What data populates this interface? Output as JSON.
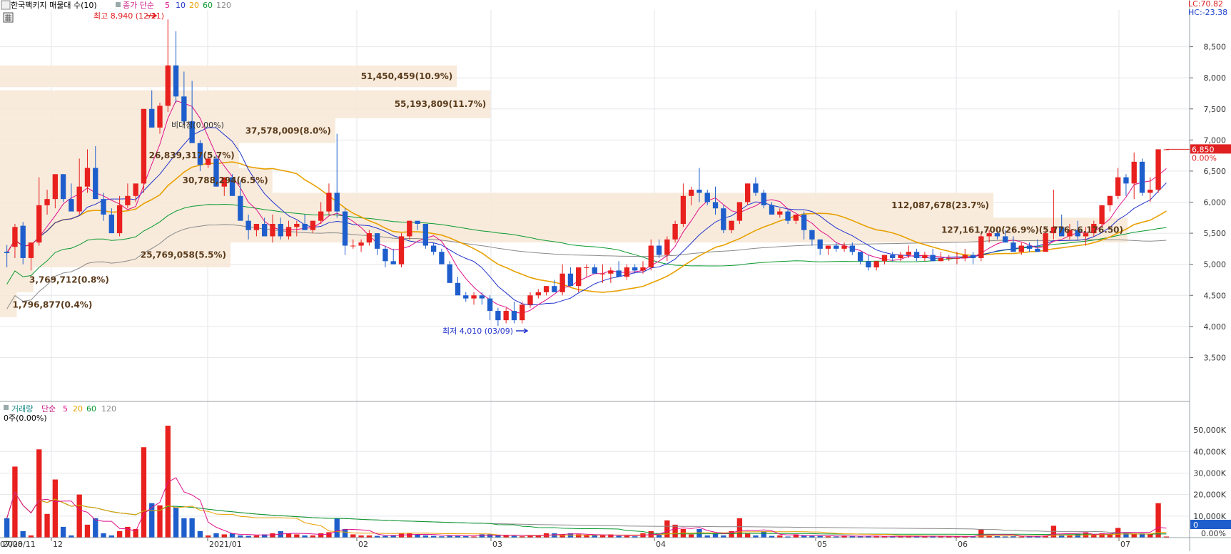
{
  "header": {
    "title": "한국팩키지 매물대 수(10)",
    "ma_label": "종가 단순",
    "ma_periods": [
      "5",
      "10",
      "20",
      "60",
      "120"
    ],
    "lc": "LC:70.82",
    "hc": "HC:-23.38"
  },
  "volume_header": {
    "title": "거래량",
    "ma_label": "단순",
    "ma_periods": [
      "5",
      "20",
      "60",
      "120"
    ],
    "current": "0주(0.00%)"
  },
  "annotations": {
    "high": "최고 8,940 (12/21)",
    "low": "최저 4,010 (03/09)",
    "bidarak": "비대칭(0.00%)"
  },
  "price_axis": {
    "ticks": [
      "8,500",
      "8,000",
      "7,500",
      "7,000",
      "6,500",
      "6,000",
      "5,500",
      "5,000",
      "4,500",
      "4,000",
      "3,500"
    ],
    "current_price": "6,850",
    "current_change": "0.00%"
  },
  "volume_axis": {
    "ticks": [
      "50,000K",
      "40,000K",
      "30,000K",
      "20,000K",
      "10,000K",
      "0.00%"
    ],
    "current": "0"
  },
  "x_axis": [
    "2020/11",
    "12",
    "2021/01",
    "02",
    "03",
    "04",
    "05",
    "06",
    "07",
    "07/08"
  ],
  "chart_data": {
    "type": "candlestick",
    "price_range": [
      3000,
      9000
    ],
    "volume_range": [
      0,
      55000
    ],
    "volume_profile": [
      {
        "label": "51,450,459(10.9%)",
        "low": 7850,
        "high": 8200,
        "pct": 10.9
      },
      {
        "label": "55,193,809(11.7%)",
        "low": 7350,
        "high": 7800,
        "pct": 11.7
      },
      {
        "label": "37,578,009(8.0%)",
        "low": 6950,
        "high": 7350,
        "pct": 8.0
      },
      {
        "label": "26,839,317(5.7%)",
        "low": 6550,
        "high": 6950,
        "pct": 5.7
      },
      {
        "label": "30,788,294(6.5%)",
        "low": 6150,
        "high": 6550,
        "pct": 6.5
      },
      {
        "label": "112,087,678(23.7%)",
        "low": 5750,
        "high": 6150,
        "pct": 23.7
      },
      {
        "label": "127,161,700(26.9%)(5.776~6.176.50)",
        "low": 5350,
        "high": 5750,
        "pct": 26.9
      },
      {
        "label": "25,769,058(5.5%)",
        "low": 4950,
        "high": 5350,
        "pct": 5.5
      },
      {
        "label": "3,769,712(0.8%)",
        "low": 4550,
        "high": 4950,
        "pct": 0.8
      },
      {
        "label": "1,796,877(0.4%)",
        "low": 4150,
        "high": 4550,
        "pct": 0.4
      }
    ],
    "candles": [
      [
        5200,
        5310,
        4950,
        5180,
        9000
      ],
      [
        5280,
        5650,
        5100,
        5600,
        33000
      ],
      [
        5620,
        5680,
        5000,
        5100,
        3000
      ],
      [
        5100,
        5200,
        4900,
        5350,
        1000
      ],
      [
        5350,
        6400,
        5300,
        5950,
        41000
      ],
      [
        5950,
        6200,
        5800,
        6050,
        11000
      ],
      [
        6050,
        6400,
        5900,
        6450,
        27000
      ],
      [
        6450,
        6450,
        6000,
        6050,
        5000
      ],
      [
        6050,
        6300,
        5900,
        5850,
        1000
      ],
      [
        5850,
        6700,
        5800,
        6250,
        20000
      ],
      [
        6250,
        6850,
        6150,
        6550,
        6000
      ],
      [
        6550,
        6900,
        6100,
        6050,
        9000
      ],
      [
        6050,
        6150,
        5700,
        5800,
        2000
      ],
      [
        5800,
        5900,
        5550,
        5500,
        1000
      ],
      [
        5500,
        6100,
        5450,
        5950,
        3000
      ],
      [
        5950,
        6300,
        5900,
        6100,
        5000
      ],
      [
        6100,
        6200,
        6000,
        6300,
        4000
      ],
      [
        6300,
        7500,
        6150,
        7500,
        42000
      ],
      [
        7500,
        7800,
        7250,
        7200,
        16000
      ],
      [
        7200,
        7600,
        7100,
        7550,
        15000
      ],
      [
        7550,
        8940,
        7450,
        8200,
        52000
      ],
      [
        8200,
        8750,
        7600,
        7700,
        14000
      ],
      [
        7700,
        8100,
        7250,
        7300,
        9000
      ],
      [
        7300,
        7950,
        7200,
        6950,
        9000
      ],
      [
        6950,
        7000,
        6500,
        6600,
        3000
      ],
      [
        6600,
        6750,
        6550,
        6700,
        1000
      ],
      [
        6700,
        6750,
        6250,
        6250,
        2000
      ],
      [
        6250,
        6400,
        6100,
        6400,
        1500
      ],
      [
        6400,
        6450,
        6100,
        6100,
        2000
      ],
      [
        6100,
        6350,
        6050,
        5700,
        1000
      ],
      [
        5700,
        5800,
        5400,
        5550,
        800
      ],
      [
        5550,
        5650,
        5450,
        5650,
        1000
      ],
      [
        5650,
        5750,
        5500,
        5450,
        1500
      ],
      [
        5450,
        5800,
        5350,
        5650,
        2000
      ],
      [
        5650,
        5750,
        5400,
        5450,
        3000
      ],
      [
        5450,
        5700,
        5400,
        5600,
        2000
      ],
      [
        5600,
        5700,
        5450,
        5650,
        1500
      ],
      [
        5650,
        5800,
        5550,
        5550,
        1000
      ],
      [
        5550,
        5700,
        5500,
        5700,
        1000
      ],
      [
        5700,
        6000,
        5650,
        5850,
        2000
      ],
      [
        5850,
        6300,
        5800,
        6150,
        2500
      ],
      [
        6150,
        7100,
        5750,
        5850,
        9000
      ],
      [
        5850,
        5900,
        5150,
        5300,
        4000
      ],
      [
        5300,
        5400,
        5250,
        5300,
        1500
      ],
      [
        5300,
        5400,
        5200,
        5350,
        1000
      ],
      [
        5350,
        5550,
        5300,
        5500,
        1000
      ],
      [
        5500,
        5450,
        5150,
        5250,
        800
      ],
      [
        5250,
        5300,
        4950,
        5050,
        800
      ],
      [
        5050,
        5250,
        5000,
        5000,
        1200
      ],
      [
        5000,
        5500,
        4950,
        5450,
        2000
      ],
      [
        5450,
        5700,
        5400,
        5700,
        2000
      ],
      [
        5700,
        5700,
        5550,
        5650,
        1500
      ],
      [
        5650,
        5650,
        5250,
        5300,
        1000
      ],
      [
        5300,
        5350,
        5150,
        5200,
        800
      ],
      [
        5200,
        5250,
        5050,
        5000,
        600
      ],
      [
        5000,
        5050,
        4700,
        4700,
        1000
      ],
      [
        4700,
        4800,
        4550,
        4500,
        1000
      ],
      [
        4500,
        4550,
        4400,
        4450,
        800
      ],
      [
        4450,
        4550,
        4350,
        4500,
        500
      ],
      [
        4500,
        4550,
        4350,
        4450,
        1500
      ],
      [
        4450,
        4500,
        4100,
        4250,
        1500
      ],
      [
        4250,
        4300,
        4010,
        4100,
        1000
      ],
      [
        4100,
        4300,
        4050,
        4250,
        1000
      ],
      [
        4250,
        4400,
        4050,
        4100,
        800
      ],
      [
        4100,
        4400,
        4050,
        4350,
        600
      ],
      [
        4350,
        4550,
        4300,
        4500,
        1000
      ],
      [
        4500,
        4600,
        4450,
        4550,
        1000
      ],
      [
        4550,
        4650,
        4500,
        4650,
        2000
      ],
      [
        4650,
        4750,
        4550,
        4550,
        2000
      ],
      [
        4550,
        5000,
        4500,
        4850,
        1500
      ],
      [
        4850,
        4950,
        4650,
        4650,
        2000
      ],
      [
        4650,
        4950,
        4550,
        4950,
        1500
      ],
      [
        4950,
        5000,
        4800,
        4950,
        1000
      ],
      [
        4950,
        5000,
        4850,
        4850,
        1000
      ],
      [
        4850,
        5000,
        4700,
        4850,
        1000
      ],
      [
        4850,
        4950,
        4700,
        4900,
        1500
      ],
      [
        4900,
        5050,
        4850,
        4800,
        800
      ],
      [
        4800,
        5000,
        4750,
        4950,
        800
      ],
      [
        4950,
        5000,
        4850,
        4900,
        600
      ],
      [
        4900,
        5050,
        4850,
        4950,
        2000
      ],
      [
        4950,
        5400,
        4900,
        5300,
        3000
      ],
      [
        5300,
        5400,
        5100,
        5150,
        1500
      ],
      [
        5150,
        5450,
        5050,
        5400,
        8000
      ],
      [
        5400,
        5700,
        5350,
        5650,
        6000
      ],
      [
        5650,
        6300,
        5600,
        6100,
        4000
      ],
      [
        6100,
        6250,
        5950,
        6200,
        1500
      ],
      [
        6200,
        6550,
        6000,
        6150,
        4000
      ],
      [
        6150,
        6200,
        5950,
        6000,
        1000
      ],
      [
        6000,
        6250,
        5800,
        5900,
        2000
      ],
      [
        5900,
        5950,
        5500,
        5550,
        1000
      ],
      [
        5550,
        5700,
        5500,
        5700,
        3000
      ],
      [
        5700,
        6000,
        5650,
        6000,
        9000
      ],
      [
        6000,
        6300,
        5950,
        6300,
        2000
      ],
      [
        6300,
        6400,
        6100,
        6150,
        1000
      ],
      [
        6150,
        6200,
        5900,
        5950,
        3000
      ],
      [
        5950,
        6000,
        5800,
        5800,
        800
      ],
      [
        5800,
        5900,
        5750,
        5850,
        1000
      ],
      [
        5850,
        5900,
        5650,
        5700,
        500
      ],
      [
        5700,
        5800,
        5650,
        5800,
        1500
      ],
      [
        5800,
        5850,
        5400,
        5550,
        1000
      ],
      [
        5550,
        5550,
        5300,
        5400,
        800
      ],
      [
        5400,
        5400,
        5150,
        5250,
        800
      ],
      [
        5250,
        5300,
        5150,
        5300,
        600
      ],
      [
        5300,
        5350,
        5200,
        5250,
        500
      ],
      [
        5250,
        5350,
        5200,
        5300,
        1000
      ],
      [
        5300,
        5350,
        5150,
        5200,
        700
      ],
      [
        5200,
        5200,
        5000,
        5050,
        500
      ],
      [
        5050,
        5150,
        4900,
        4950,
        800
      ],
      [
        4950,
        5050,
        4900,
        5050,
        600
      ],
      [
        5050,
        5150,
        5000,
        5150,
        500
      ],
      [
        5150,
        5200,
        5050,
        5100,
        500
      ],
      [
        5100,
        5200,
        5050,
        5150,
        500
      ],
      [
        5150,
        5300,
        5100,
        5200,
        800
      ],
      [
        5200,
        5250,
        5050,
        5100,
        700
      ],
      [
        5100,
        5200,
        5050,
        5150,
        500
      ],
      [
        5150,
        5250,
        5050,
        5050,
        600
      ],
      [
        5050,
        5200,
        5050,
        5100,
        600
      ],
      [
        5100,
        5150,
        5050,
        5100,
        500
      ],
      [
        5100,
        5200,
        5000,
        5100,
        500
      ],
      [
        5100,
        5250,
        5050,
        5150,
        600
      ],
      [
        5150,
        5200,
        5000,
        5100,
        500
      ],
      [
        5100,
        5500,
        5050,
        5450,
        4000
      ],
      [
        5450,
        5550,
        5350,
        5500,
        1000
      ],
      [
        5500,
        5550,
        5400,
        5450,
        800
      ],
      [
        5450,
        5550,
        5350,
        5350,
        500
      ],
      [
        5350,
        5450,
        5250,
        5200,
        600
      ],
      [
        5200,
        5350,
        5150,
        5300,
        500
      ],
      [
        5300,
        5350,
        5200,
        5250,
        500
      ],
      [
        5250,
        5400,
        5200,
        5200,
        800
      ],
      [
        5200,
        5550,
        5200,
        5500,
        1000
      ],
      [
        5500,
        6200,
        5400,
        5600,
        5500
      ],
      [
        5600,
        5800,
        5550,
        5450,
        1000
      ],
      [
        5450,
        5650,
        5400,
        5550,
        1000
      ],
      [
        5550,
        5700,
        5400,
        5450,
        1500
      ],
      [
        5450,
        5600,
        5300,
        5500,
        2500
      ],
      [
        5500,
        5700,
        5450,
        5650,
        1500
      ],
      [
        5650,
        5950,
        5600,
        5950,
        2000
      ],
      [
        5950,
        6100,
        5850,
        6100,
        1500
      ],
      [
        6100,
        6550,
        6050,
        6400,
        4500
      ],
      [
        6400,
        6450,
        6100,
        6300,
        2500
      ],
      [
        6300,
        6800,
        6050,
        6650,
        2000
      ],
      [
        6650,
        6700,
        6100,
        6150,
        2000
      ],
      [
        6150,
        6400,
        6000,
        6200,
        1500
      ],
      [
        6200,
        6850,
        6150,
        6850,
        16000
      ],
      [
        6850,
        6850,
        6850,
        6850,
        500
      ]
    ]
  }
}
